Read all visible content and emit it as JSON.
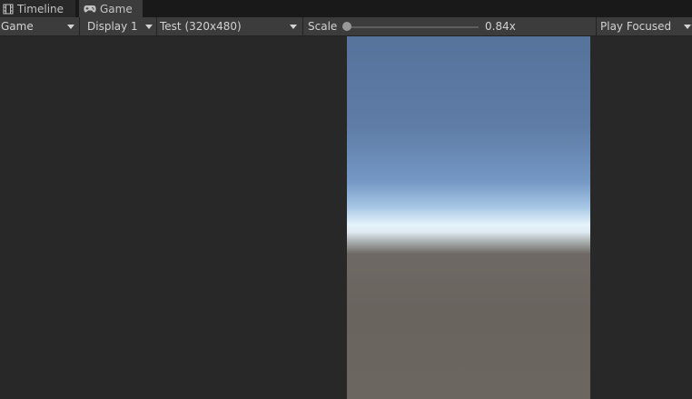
{
  "tabs": [
    {
      "label": "Timeline",
      "icon": "film-strip-icon"
    },
    {
      "label": "Game",
      "icon": "gamepad-icon",
      "active": true
    }
  ],
  "toolbar": {
    "view_mode": "Game",
    "display": "Display 1",
    "resolution": "Test (320x480)",
    "scale_label": "Scale",
    "scale_value": "0.84x",
    "scale": 0.84,
    "play_mode": "Play Focused"
  },
  "colors": {
    "background": "#282828",
    "toolbar": "#3c3c3c",
    "sky_top": "#56739c",
    "horizon": "#e6f3fb",
    "ground": "#6c6660"
  }
}
